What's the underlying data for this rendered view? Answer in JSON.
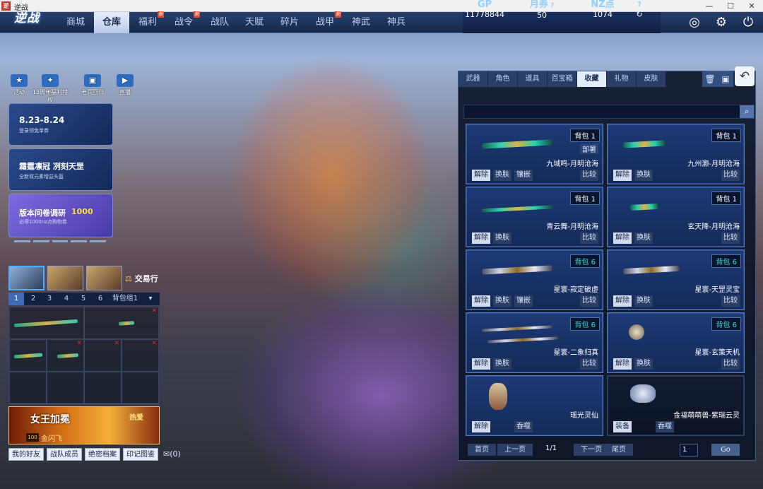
{
  "window": {
    "title": "逆战",
    "icon": "逆"
  },
  "logo": "逆战",
  "nav": [
    {
      "label": "商城",
      "new": false
    },
    {
      "label": "仓库",
      "new": false,
      "active": true
    },
    {
      "label": "福利",
      "new": true
    },
    {
      "label": "战令",
      "new": true
    },
    {
      "label": "战队",
      "new": false
    },
    {
      "label": "天赋",
      "new": false
    },
    {
      "label": "碎片",
      "new": false
    },
    {
      "label": "战甲",
      "new": true
    },
    {
      "label": "神武",
      "new": false
    },
    {
      "label": "神兵",
      "new": false
    }
  ],
  "new_tag": "新",
  "currency": {
    "gp_label": "GP",
    "gp_value": "11778844",
    "ticket_label": "月券",
    "ticket_value": "50",
    "nz_label": "NZ点",
    "nz_value": "1074"
  },
  "activities": [
    "活动",
    "13周年福利特权",
    "老兵回归",
    "直播"
  ],
  "cards": {
    "c1_title": "8.23-8.24",
    "c1_sub": "登录领免单券",
    "c2_title": "霜霆凛冠 冽刻天罡",
    "c2_sub": "全新双元素增益头盔",
    "c3_title": "版本问卷调研",
    "c3_sub": "必得1000nz点购物券",
    "c3_badge": "1000"
  },
  "trade_label": "交易行",
  "bag_tabs": [
    "1",
    "2",
    "3",
    "4",
    "5",
    "6",
    "背包组1"
  ],
  "banner": {
    "title": "女王加冕",
    "hot": "热爱",
    "level": "100",
    "sub": "金闪飞"
  },
  "bottom_buttons": [
    "我的好友",
    "战队成员",
    "绝密档案",
    "印记图鉴"
  ],
  "mail_count": "(0)",
  "right_tabs": [
    "武器",
    "角色",
    "道具",
    "百宝箱",
    "收藏",
    "礼物",
    "皮肤"
  ],
  "right_tab_selected": 4,
  "items": [
    {
      "bag": "背包 1",
      "name": "九域鸣-月明沧海",
      "tag": "部署",
      "buttons": [
        "解除",
        "换肤",
        "镶嵌"
      ],
      "compare": "比较"
    },
    {
      "bag": "背包 1",
      "name": "九州灏-月明沧海",
      "buttons": [
        "解除",
        "换肤"
      ],
      "compare": "比较"
    },
    {
      "bag": "背包 1",
      "name": "青云舞-月明沧海",
      "buttons": [
        "解除",
        "换肤"
      ],
      "compare": "比较"
    },
    {
      "bag": "背包 1",
      "name": "玄天降-月明沧海",
      "buttons": [
        "解除",
        "换肤"
      ],
      "compare": "比较"
    },
    {
      "bag": "背包 6",
      "name": "星寰-寂定破虚",
      "buttons": [
        "解除",
        "换肤",
        "镶嵌"
      ],
      "compare": "比较"
    },
    {
      "bag": "背包 6",
      "name": "星寰-天罡灵宝",
      "buttons": [
        "解除",
        "换肤"
      ],
      "compare": "比较"
    },
    {
      "bag": "背包 6",
      "name": "星寰-二象归真",
      "buttons": [
        "解除",
        "换肤"
      ],
      "compare": "比较"
    },
    {
      "bag": "背包 6",
      "name": "星寰-玄策天机",
      "buttons": [
        "解除",
        "换肤"
      ],
      "compare": "比较"
    },
    {
      "name": "瑶光灵仙",
      "buttons": [
        "解除"
      ],
      "extra": "吞噬"
    },
    {
      "name": "金福萌萌兽-紫瑞云灵",
      "buttons": [
        "装备"
      ],
      "extra": "吞噬"
    }
  ],
  "pager": {
    "first": "首页",
    "prev": "上一页",
    "info": "1/1",
    "next": "下一页",
    "last": "尾页",
    "input": "1",
    "go": "Go"
  }
}
